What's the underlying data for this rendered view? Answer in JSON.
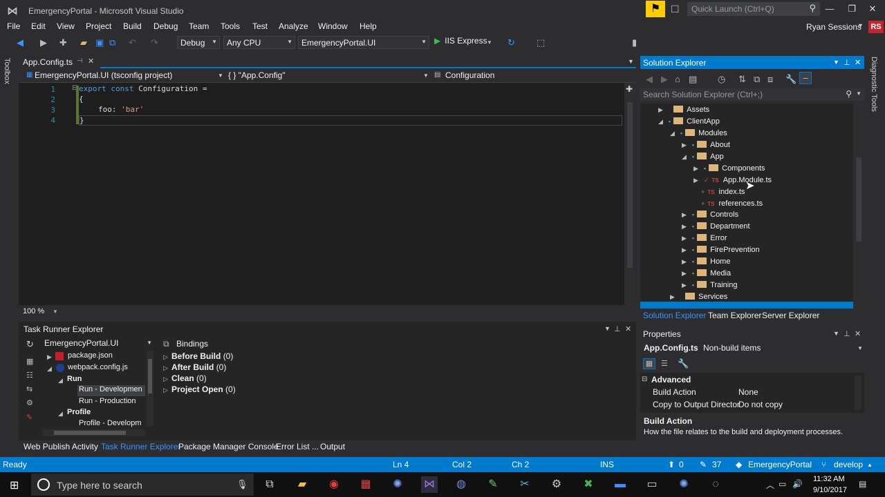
{
  "window": {
    "title": "EmergencyPortal - Microsoft Visual Studio",
    "quick_launch_placeholder": "Quick Launch (Ctrl+Q)",
    "user": "Ryan Sessions",
    "avatar_initials": "RS"
  },
  "menu": [
    "File",
    "Edit",
    "View",
    "Project",
    "Build",
    "Debug",
    "Team",
    "Tools",
    "Test",
    "Analyze",
    "Window",
    "Help"
  ],
  "toolbar": {
    "config": "Debug",
    "platform": "Any CPU",
    "startup_project": "EmergencyPortal.UI",
    "run_target": "IIS Express"
  },
  "side_strips": {
    "left": "Toolbox",
    "right": "Diagnostic Tools"
  },
  "editor": {
    "tab": "App.Config.ts",
    "nav_project": "EmergencyPortal.UI (tsconfig project)",
    "nav_scope": "{ } \"App.Config\"",
    "nav_member": "Configuration",
    "zoom": "100 %",
    "line_numbers": [
      "1",
      "2",
      "3",
      "4"
    ],
    "code": {
      "l1_kw1": "export",
      "l1_kw2": "const",
      "l1_rest": " Configuration =",
      "l2": "{",
      "l3_key": "foo: ",
      "l3_val": "'bar'",
      "l4": "}"
    }
  },
  "task_runner": {
    "title": "Task Runner Explorer",
    "project": "EmergencyPortal.UI",
    "tree": {
      "package_json": "package.json",
      "webpack": "webpack.config.js",
      "run": "Run",
      "run_dev": "Run - Developmen",
      "run_prod": "Run - Production",
      "profile": "Profile",
      "profile_dev": "Profile - Developm"
    },
    "bindings_title": "Bindings",
    "bindings": [
      {
        "label": "Before Build",
        "count": "(0)"
      },
      {
        "label": "After Build",
        "count": "(0)"
      },
      {
        "label": "Clean",
        "count": "(0)"
      },
      {
        "label": "Project Open",
        "count": "(0)"
      }
    ]
  },
  "bottom_tabs": [
    "Web Publish Activity",
    "Task Runner Explorer",
    "Package Manager Console",
    "Error List ...",
    "Output"
  ],
  "solution_explorer": {
    "title": "Solution Explorer",
    "search_placeholder": "Search Solution Explorer (Ctrl+;)",
    "nodes": {
      "assets": "Assets",
      "clientapp": "ClientApp",
      "modules": "Modules",
      "about": "About",
      "app": "App",
      "components": "Components",
      "app_module": "App.Module.ts",
      "index": "index.ts",
      "references": "references.ts",
      "controls": "Controls",
      "department": "Department",
      "error": "Error",
      "fireprevention": "FirePrevention",
      "home": "Home",
      "media": "Media",
      "training": "Training",
      "services": "Services"
    },
    "tabs": [
      "Solution Explorer",
      "Team Explorer",
      "Server Explorer"
    ]
  },
  "properties": {
    "title": "Properties",
    "object_name": "App.Config.ts",
    "object_type": "Non-build items",
    "category": "Advanced",
    "rows": [
      {
        "name": "Build Action",
        "value": "None"
      },
      {
        "name": "Copy to Output Director",
        "value": "Do not copy"
      }
    ],
    "desc_title": "Build Action",
    "desc_text": "How the file relates to the build and deployment processes."
  },
  "statusbar": {
    "ready": "Ready",
    "ln": "Ln 4",
    "col": "Col 2",
    "ch": "Ch 2",
    "ins": "INS",
    "up_count": "0",
    "edit_count": "37",
    "repo": "EmergencyPortal",
    "branch": "develop"
  },
  "taskbar": {
    "search_placeholder": "Type here to search",
    "time": "11:32 AM",
    "date": "9/10/2017"
  },
  "colors": {
    "accent": "#007acc",
    "editor_bg": "#1e1e1e",
    "chrome_bg": "#2d2d30",
    "keyword": "#569cd6",
    "string": "#d69d85"
  }
}
